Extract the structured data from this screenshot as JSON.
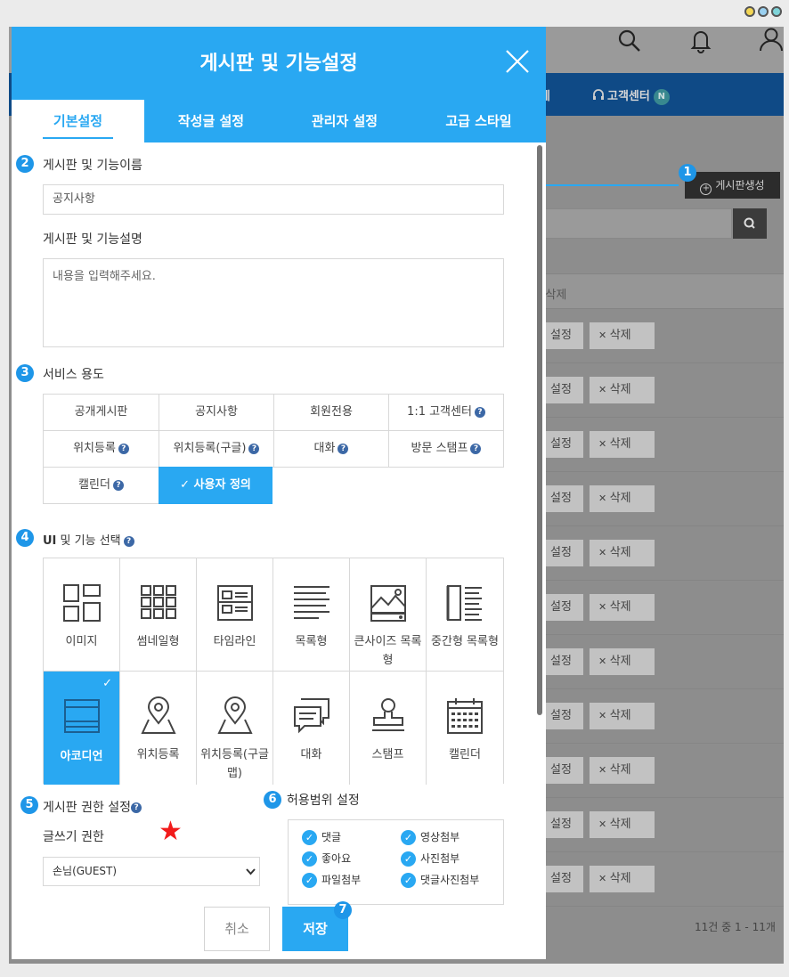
{
  "background_app": {
    "nav_item_partial": "제",
    "nav_support": "고객센터",
    "nav_support_badge": "N",
    "create_board_label": "게시판생성",
    "list_header_partial": "/삭제",
    "row_edit_label": "설정",
    "row_delete_label": "삭제",
    "row_count": 11,
    "pagination_text": "11건 중 1 - 11개"
  },
  "dialog": {
    "title": "게시판 및 기능설정",
    "tabs": [
      {
        "label": "기본설정",
        "active": true
      },
      {
        "label": "작성글 설정",
        "active": false
      },
      {
        "label": "관리자 설정",
        "active": false
      },
      {
        "label": "고급 스타일",
        "active": false
      }
    ],
    "name_section": {
      "number": "2",
      "label": "게시판 및 기능이름",
      "value": "공지사항"
    },
    "desc_section": {
      "label": "게시판 및 기능설명",
      "placeholder": "내용을 입력해주세요."
    },
    "service_section": {
      "number": "3",
      "label": "서비스 용도",
      "options": [
        {
          "label": "공개게시판",
          "help": false,
          "selected": false
        },
        {
          "label": "공지사항",
          "help": false,
          "selected": false
        },
        {
          "label": "회원전용",
          "help": false,
          "selected": false
        },
        {
          "label": "1:1 고객센터",
          "help": true,
          "selected": false
        },
        {
          "label": "위치등록",
          "help": true,
          "selected": false
        },
        {
          "label": "위치등록(구글)",
          "help": true,
          "selected": false
        },
        {
          "label": "대화",
          "help": true,
          "selected": false
        },
        {
          "label": "방문 스탬프",
          "help": true,
          "selected": false
        },
        {
          "label": "캘린더",
          "help": true,
          "selected": false
        },
        {
          "label": "사용자 정의",
          "help": false,
          "selected": true
        }
      ]
    },
    "ui_section": {
      "number": "4",
      "label_strong": "UI",
      "label": "및 기능 선택",
      "options": [
        {
          "label": "이미지",
          "icon": "image-layout-icon",
          "selected": false
        },
        {
          "label": "썸네일형",
          "icon": "thumbnail-grid-icon",
          "selected": false
        },
        {
          "label": "타임라인",
          "icon": "timeline-icon",
          "selected": false
        },
        {
          "label": "목록형",
          "icon": "list-icon",
          "selected": false
        },
        {
          "label": "큰사이즈 목록형",
          "icon": "large-list-icon",
          "selected": false
        },
        {
          "label": "중간형 목록형",
          "icon": "medium-list-icon",
          "selected": false
        },
        {
          "label": "아코디언",
          "icon": "accordion-icon",
          "selected": true
        },
        {
          "label": "위치등록",
          "icon": "location-pin-icon",
          "selected": false
        },
        {
          "label": "위치등록(구글맵)",
          "icon": "google-map-pin-icon",
          "selected": false
        },
        {
          "label": "대화",
          "icon": "chat-icon",
          "selected": false
        },
        {
          "label": "스탬프",
          "icon": "stamp-icon",
          "selected": false
        },
        {
          "label": "캘린더",
          "icon": "calendar-icon",
          "selected": false
        }
      ]
    },
    "permission_section": {
      "number": "5",
      "label": "게시판 권한 설정",
      "write_label": "글쓰기 권한",
      "write_value": "손님(GUEST)"
    },
    "scope_section": {
      "number": "6",
      "label": "허용범위 설정",
      "options": [
        {
          "label": "댓글",
          "checked": true
        },
        {
          "label": "영상첨부",
          "checked": true
        },
        {
          "label": "좋아요",
          "checked": true
        },
        {
          "label": "사진첨부",
          "checked": true
        },
        {
          "label": "파일첨부",
          "checked": true
        },
        {
          "label": "댓글사진첨부",
          "checked": true
        }
      ]
    },
    "buttons": {
      "cancel": "취소",
      "save": "저장",
      "save_step": "7"
    },
    "callout_step": "1"
  },
  "colors": {
    "accent": "#29a8f2",
    "step_badge": "#1e96e8",
    "star": "#f21b1b",
    "help_icon": "#3c68a6"
  }
}
